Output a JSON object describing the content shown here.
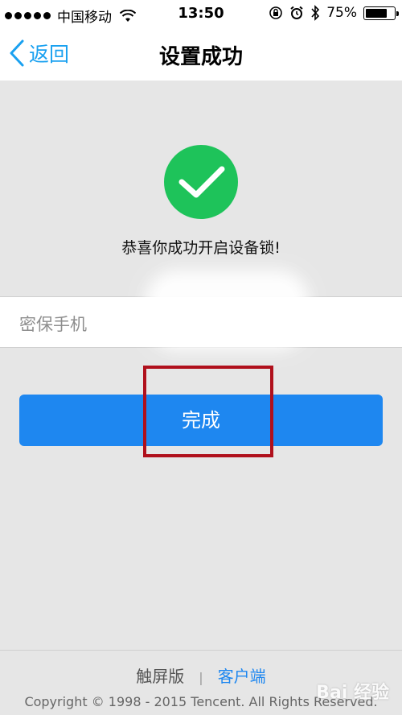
{
  "status_bar": {
    "carrier": "中国移动",
    "time": "13:50",
    "battery": "75%",
    "battery_level": 0.75
  },
  "nav": {
    "back_label": "返回",
    "title": "设置成功"
  },
  "success": {
    "message": "恭喜你成功开启设备锁!"
  },
  "phone_row": {
    "label": "密保手机"
  },
  "done_button": {
    "label": "完成"
  },
  "footer": {
    "touch_version": "触屏版",
    "separator": "|",
    "client": "客户端",
    "copyright": "Copyright © 1998 - 2015 Tencent. All Rights Reserved."
  },
  "watermark": "Bai 经验",
  "colors": {
    "accent": "#1e87f0",
    "success": "#1ec35a",
    "highlight": "#b0101c"
  }
}
